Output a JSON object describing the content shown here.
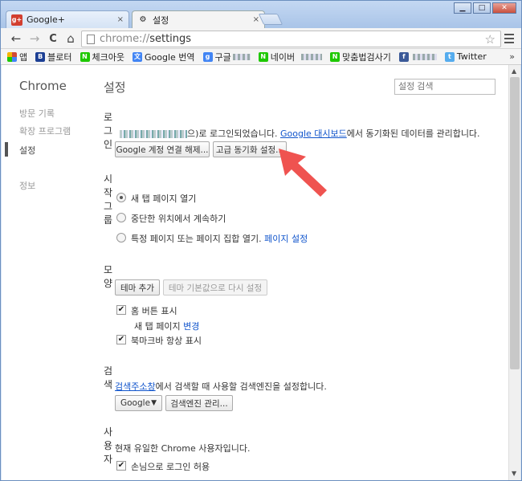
{
  "tabs": [
    {
      "label": "Google+",
      "icon": "google-plus-icon",
      "close": "×"
    },
    {
      "label": "설정",
      "icon": "gear-icon",
      "close": "×"
    }
  ],
  "window_controls": {
    "minimize": "▁",
    "maximize": "□",
    "close": "✕"
  },
  "toolbar": {
    "back": "←",
    "forward": "→",
    "reload": "C",
    "home": "⌂",
    "url_scheme": "chrome://",
    "url_path": "settings",
    "star": "☆"
  },
  "bookmarks": [
    {
      "label": "앱",
      "icon": "apps-icon",
      "color": "#d14836"
    },
    {
      "label": "블로터",
      "icon": "bloter-icon",
      "color": "#1c3f94"
    },
    {
      "label": "체크아웃",
      "icon": "naver-icon",
      "color": "#1ec800"
    },
    {
      "label": "Google 번역",
      "icon": "translate-icon",
      "color": "#4285f4"
    },
    {
      "label": "구글",
      "icon": "google-icon",
      "color": "#4285f4"
    },
    {
      "label": "네이버",
      "icon": "naver-icon",
      "color": "#1ec800"
    },
    {
      "label": "맞춤법검사기",
      "icon": "naver-icon",
      "color": "#1ec800"
    },
    {
      "label": "Twitter",
      "icon": "twitter-icon",
      "color": "#55acee"
    }
  ],
  "bookmarks_more": "»",
  "sidebar": {
    "brand": "Chrome",
    "items": [
      "방문 기록",
      "확장 프로그램",
      "설정",
      "정보"
    ]
  },
  "main": {
    "title": "설정",
    "search_placeholder": "설정 검색",
    "login": {
      "title": "로그인",
      "text_before": "으)로 로그인되었습니다.",
      "dashboard_link": "Google 대시보드",
      "text_after": "에서 동기화된 데이터를 관리합니다.",
      "disconnect_button": "Google 계정 연결 해제...",
      "advanced_sync_button": "고급 동기화 설정..."
    },
    "startup": {
      "title": "시작 그룹",
      "options": [
        "새 탭 페이지 열기",
        "중단한 위치에서 계속하기",
        "특정 페이지 또는 페이지 집합 열기."
      ],
      "page_settings_link": "페이지 설정"
    },
    "appearance": {
      "title": "모양",
      "add_theme_button": "테마 추가",
      "reset_theme_button": "테마 기본값으로 다시 설정",
      "home_button_label": "홈 버튼 표시",
      "new_tab_text": "새 탭 페이지",
      "change_link": "변경",
      "bookmarks_bar_label": "북마크바 항상 표시"
    },
    "search": {
      "title": "검색",
      "omnibox_link": "검색주소창",
      "text": "에서 검색할 때 사용할 검색엔진을 설정합니다.",
      "engine_value": "Google",
      "manage_button": "검색엔진 관리..."
    },
    "users": {
      "title": "사용자",
      "text": "현재 유일한 Chrome 사용자입니다.",
      "guest_login_label": "손님으로 로그인 허용"
    }
  },
  "annotation_color": "#ef5350"
}
